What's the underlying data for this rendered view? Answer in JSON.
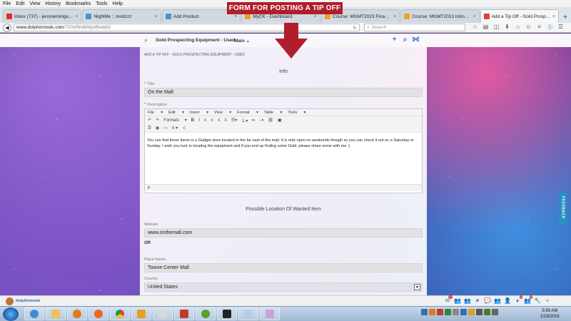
{
  "menubar": [
    "File",
    "Edit",
    "View",
    "History",
    "Bookmarks",
    "Tools",
    "Help"
  ],
  "tabs": [
    {
      "label": "Inbox (737) - jeromemingo...",
      "color": "#d93025",
      "active": false
    },
    {
      "label": "Nightlife :: modzzz",
      "color": "#4a90d9",
      "active": false
    },
    {
      "label": "Add Product",
      "color": "#4a90d9",
      "active": false
    },
    {
      "label": "MyCK - Dashboard",
      "color": "#f0a030",
      "active": false
    },
    {
      "label": "Course: MGMT2023 Financi...",
      "color": "#f0a030",
      "active": false
    },
    {
      "label": "Course: MGMT2013 Introd...",
      "color": "#f0a030",
      "active": false
    },
    {
      "label": "Add a Tip Off - Gold Prosp...",
      "color": "#e04040",
      "active": true
    }
  ],
  "url": {
    "site": "www.dolphinmods.com",
    "path": "/72/m/findit/tipoff/add/2"
  },
  "search_placeholder": "Search",
  "sitebar": {
    "crumb": "Gold Prospecting Equipment - Used",
    "main": "Main"
  },
  "annotation": "FORM FOR POSTING A TIP OFF",
  "form": {
    "breadcrumb": "ADD A TIP OFF - GOLD PROSPECTING EQUIPMENT - USED",
    "info_title": "Info",
    "title_label": "Title",
    "title_value": "On the Mall",
    "description_label": "Description",
    "editor_menu": [
      "File",
      "Edit",
      "Insert",
      "View",
      "Format",
      "Table",
      "Tools"
    ],
    "editor_formats": "Formats",
    "description_value": "You can find these items in a Gadget store located to the far east of the mall. It is only open on weekends though so you can check it out on a Saturday or Sunday. I wish you luck in locating the equipment and if you end up finding some Gold, please share some with me :)",
    "editor_status": "p",
    "location_title": "Possible Location Of Wanted Item",
    "website_label": "Website",
    "website_value": "www.onthemall.com",
    "or_label": "OR",
    "place_label": "Place Name",
    "place_value": "Towne Center Mall",
    "country_label": "Country",
    "country_value": "United States"
  },
  "feedback": "FEEDBACK",
  "bottombar_user": "dolphinmods",
  "clock": {
    "time": "5:59 AM",
    "date": "1/18/2016"
  },
  "colors": {
    "accent": "#2a7fd1",
    "annotation": "#b11d2b"
  }
}
